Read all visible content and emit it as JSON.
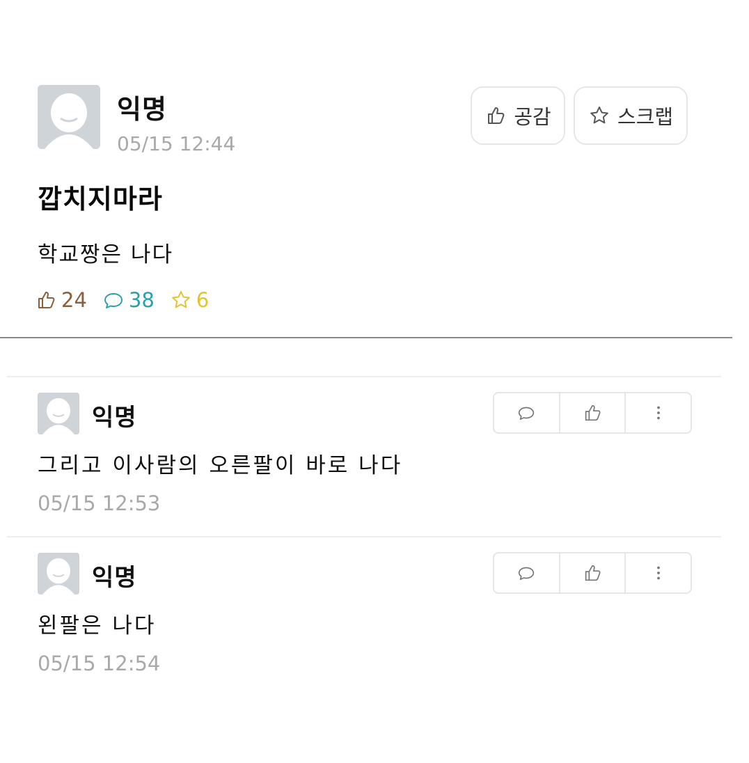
{
  "post": {
    "author": "익명",
    "timestamp": "05/15 12:44",
    "like_button_label": "공감",
    "scrap_button_label": "스크랩",
    "title": "깝치지마라",
    "body": "학교짱은 나다",
    "stats": {
      "likes": "24",
      "comments": "38",
      "scraps": "6",
      "like_color": "#8b5e3c",
      "comment_color": "#2aa0a8",
      "scrap_color": "#e2c430"
    }
  },
  "comments": [
    {
      "author": "익명",
      "text": "그리고 이사람의 오른팔이 바로 나다",
      "timestamp": "05/15 12:53"
    },
    {
      "author": "익명",
      "text": "왼팔은 나다",
      "timestamp": "05/15 12:54"
    }
  ],
  "icons": {
    "avatar": "avatar-icon",
    "like": "thumbs-up-icon",
    "scrap": "star-icon",
    "comment": "speech-bubble-icon",
    "more": "more-vertical-icon"
  }
}
